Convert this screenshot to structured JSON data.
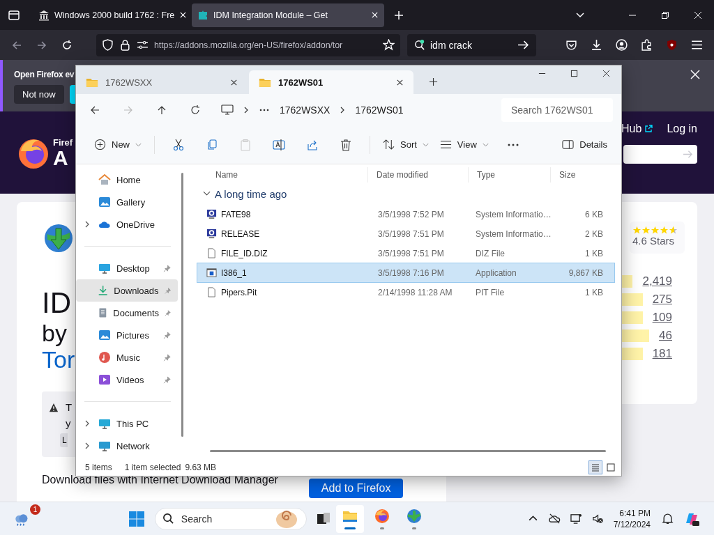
{
  "browser": {
    "tabs": [
      {
        "title": "Windows 2000 build 1762 : Fre",
        "selected": false
      },
      {
        "title": "IDM Integration Module – Get",
        "selected": true
      }
    ],
    "url": "https://addons.mozilla.org/en-US/firefox/addon/tor",
    "search": {
      "value": "idm crack"
    },
    "notification": {
      "text": "Open Firefox ev",
      "button": "Not now"
    }
  },
  "page": {
    "header": {
      "logo_text": "Firef",
      "logo_title": "A",
      "hub": "Hub",
      "login": "Log in"
    },
    "addon": {
      "name": "ID",
      "by": "by",
      "author": "Tor",
      "warning": {
        "lines": [
          "T",
          "y"
        ],
        "button": "L"
      },
      "summary": "Download files with Internet Download Manager",
      "install": "Add to Firefox"
    },
    "rating": {
      "stars": 4.6,
      "label": "4.6 Stars",
      "bars": [
        {
          "count": "2,419",
          "level": 1
        },
        {
          "count": "275",
          "level": 1
        },
        {
          "count": "109",
          "level": 1
        },
        {
          "count": "46",
          "level": 1
        },
        {
          "count": "181",
          "level": 1
        }
      ]
    }
  },
  "explorer": {
    "tabs": [
      {
        "title": "1762WSXX",
        "selected": false
      },
      {
        "title": "1762WS01",
        "selected": true
      }
    ],
    "breadcrumb": [
      "1762WSXX",
      "1762WS01"
    ],
    "search": {
      "placeholder": "Search 1762WS01"
    },
    "toolbar": {
      "new": "New",
      "sort": "Sort",
      "view": "View",
      "details": "Details"
    },
    "sidebar": [
      {
        "items": [
          {
            "label": "Home",
            "expandable": false,
            "pinned": false,
            "selected": false
          },
          {
            "label": "Gallery",
            "expandable": false,
            "pinned": false,
            "selected": false
          },
          {
            "label": "OneDrive",
            "expandable": true,
            "pinned": false,
            "selected": false
          }
        ]
      },
      {
        "items": [
          {
            "label": "Desktop",
            "expandable": false,
            "pinned": true,
            "selected": false
          },
          {
            "label": "Downloads",
            "expandable": false,
            "pinned": true,
            "selected": true
          },
          {
            "label": "Documents",
            "expandable": false,
            "pinned": true,
            "selected": false
          },
          {
            "label": "Pictures",
            "expandable": false,
            "pinned": true,
            "selected": false
          },
          {
            "label": "Music",
            "expandable": false,
            "pinned": true,
            "selected": false
          },
          {
            "label": "Videos",
            "expandable": false,
            "pinned": true,
            "selected": false
          }
        ]
      },
      {
        "items": [
          {
            "label": "This PC",
            "expandable": true,
            "pinned": false,
            "selected": false
          },
          {
            "label": "Network",
            "expandable": true,
            "pinned": false,
            "selected": false
          }
        ]
      }
    ],
    "columns": [
      "Name",
      "Date modified",
      "Type",
      "Size"
    ],
    "group": {
      "label": "A long time ago",
      "expanded": true
    },
    "files": [
      {
        "name": "FATE98",
        "date": "3/5/1998 7:52 PM",
        "type": "System Informatio…",
        "size": "6 KB",
        "kind": "sysinfo",
        "selected": false
      },
      {
        "name": "RELEASE",
        "date": "3/5/1998 7:51 PM",
        "type": "System Informatio…",
        "size": "2 KB",
        "kind": "sysinfo",
        "selected": false
      },
      {
        "name": "FILE_ID.DIZ",
        "date": "3/5/1998 7:51 PM",
        "type": "DIZ File",
        "size": "1 KB",
        "kind": "blank",
        "selected": false
      },
      {
        "name": "I386_1",
        "date": "3/5/1998 7:16 PM",
        "type": "Application",
        "size": "9,867 KB",
        "kind": "app",
        "selected": true
      },
      {
        "name": "Pipers.Pit",
        "date": "2/14/1998 11:28 AM",
        "type": "PIT File",
        "size": "1 KB",
        "kind": "blank",
        "selected": false
      }
    ],
    "status": {
      "count": "5 items",
      "selection": "1 item selected",
      "size": "9.63 MB"
    },
    "views": [
      {
        "selected": true
      },
      {
        "selected": false
      }
    ]
  },
  "taskbar": {
    "badge": "1",
    "search": {
      "placeholder": "Search"
    },
    "apps": [
      {
        "kind": "explorer",
        "active": true
      },
      {
        "kind": "firefox",
        "active": false
      },
      {
        "kind": "idm",
        "active": false
      }
    ],
    "time": "6:41 PM",
    "date": "7/12/2024"
  }
}
